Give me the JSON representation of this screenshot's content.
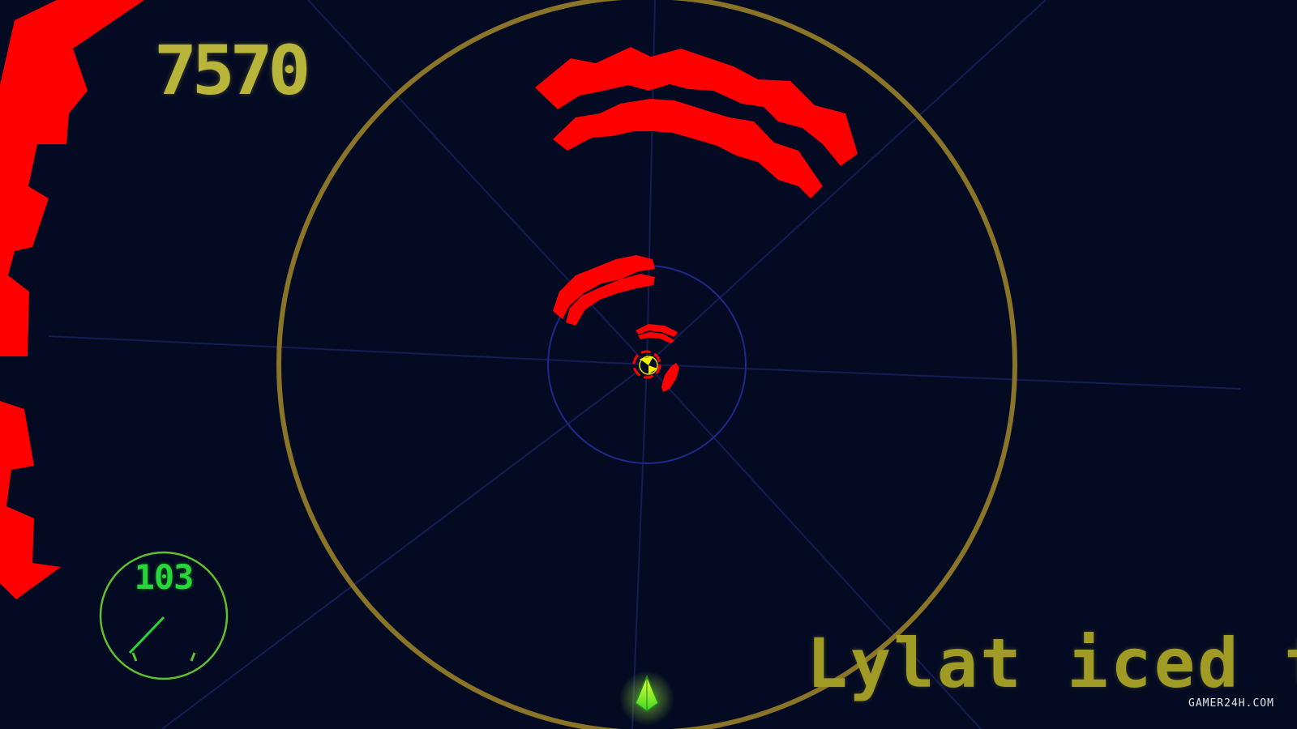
{
  "hud": {
    "score": "7570",
    "speed": "103",
    "song_title": "Lylat iced tea"
  },
  "watermark": "GAMER24H.COM",
  "colors": {
    "background": "#040a22",
    "hazard": "#ff0000",
    "ring": "#8a7427",
    "score_text": "#b9b43a",
    "song_text": "#9f9b25",
    "gauge": "#29d63a",
    "player": "#a6e800"
  },
  "icons": {
    "player_ship": "player-ship-icon",
    "core": "core-icon",
    "gauge_needle": "gauge-needle-icon"
  }
}
